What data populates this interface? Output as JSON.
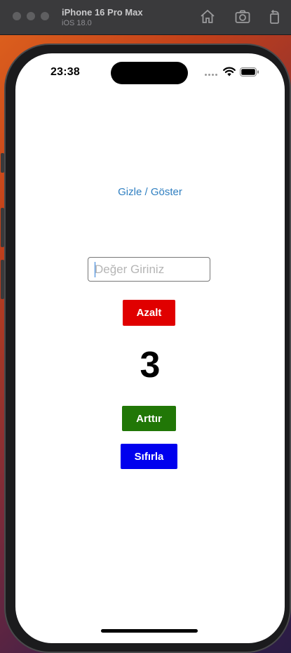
{
  "simulator": {
    "device_name": "iPhone 16 Pro Max",
    "os_version": "iOS 18.0",
    "toolbar_icons": [
      "home-icon",
      "screenshot-icon",
      "rotate-icon"
    ]
  },
  "status_bar": {
    "time": "23:38",
    "icons": [
      "cellular-dots-icon",
      "wifi-icon",
      "battery-icon"
    ]
  },
  "app": {
    "toggle_label": "Gizle / Göster",
    "input": {
      "placeholder": "Değer Giriniz",
      "value": ""
    },
    "decrease_label": "Azalt",
    "counter_value": "3",
    "increase_label": "Arttır",
    "reset_label": "Sıfırla"
  },
  "colors": {
    "link": "#2f7fc1",
    "decrease": "#e00000",
    "increase": "#217707",
    "reset": "#0000ee"
  }
}
